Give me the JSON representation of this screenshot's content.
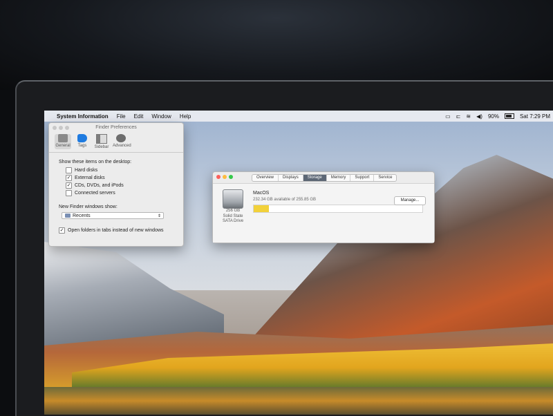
{
  "menubar": {
    "app_name": "System Information",
    "items": [
      "File",
      "Edit",
      "Window",
      "Help"
    ],
    "battery_percent": "90%",
    "clock": "Sat 7:29 PM"
  },
  "finder_prefs": {
    "title": "Finder Preferences",
    "tabs": [
      {
        "label": "General",
        "icon": "general-icon",
        "selected": true
      },
      {
        "label": "Tags",
        "icon": "tag-icon",
        "selected": false
      },
      {
        "label": "Sidebar",
        "icon": "sidebar-icon",
        "selected": false
      },
      {
        "label": "Advanced",
        "icon": "gear-icon",
        "selected": false
      }
    ],
    "desktop_heading": "Show these items on the desktop:",
    "desktop_items": [
      {
        "label": "Hard disks",
        "checked": false
      },
      {
        "label": "External disks",
        "checked": true
      },
      {
        "label": "CDs, DVDs, and iPods",
        "checked": true
      },
      {
        "label": "Connected servers",
        "checked": false
      }
    ],
    "new_window_heading": "New Finder windows show:",
    "new_window_value": "Recents",
    "tabs_option": {
      "label": "Open folders in tabs instead of new windows",
      "checked": true
    }
  },
  "sysinfo": {
    "tabs": [
      {
        "label": "Overview",
        "active": false
      },
      {
        "label": "Displays",
        "active": false
      },
      {
        "label": "Storage",
        "active": true
      },
      {
        "label": "Memory",
        "active": false
      },
      {
        "label": "Support",
        "active": false
      },
      {
        "label": "Service",
        "active": false
      }
    ],
    "disk_caption": [
      "256 GB",
      "Solid State",
      "SATA Drive"
    ],
    "volume_name": "MacOS",
    "volume_available": "232.34 GB available of 255.85 GB",
    "used_fraction": 0.09,
    "used_color": "#f2d13a",
    "manage_label": "Manage..."
  }
}
